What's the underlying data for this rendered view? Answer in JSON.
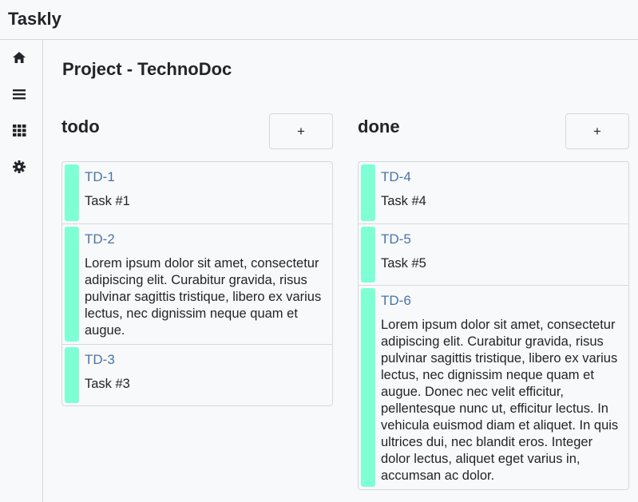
{
  "app": {
    "title": "Taskly"
  },
  "sidebar": {
    "items": [
      {
        "icon": "home-icon"
      },
      {
        "icon": "list-icon"
      },
      {
        "icon": "grid-icon"
      },
      {
        "icon": "gear-icon"
      }
    ]
  },
  "page": {
    "title": "Project - TechnoDoc"
  },
  "columns": [
    {
      "title": "todo",
      "add_label": "+",
      "cards": [
        {
          "id": "TD-1",
          "text": "Task #1"
        },
        {
          "id": "TD-2",
          "text": "Lorem ipsum dolor sit amet, consectetur adipiscing elit. Curabitur gravida, risus pulvinar sagittis tristique, libero ex varius lectus, nec dignissim neque quam et augue."
        },
        {
          "id": "TD-3",
          "text": "Task #3"
        }
      ]
    },
    {
      "title": "done",
      "add_label": "+",
      "cards": [
        {
          "id": "TD-4",
          "text": "Task #4"
        },
        {
          "id": "TD-5",
          "text": "Task #5"
        },
        {
          "id": "TD-6",
          "text": "Lorem ipsum dolor sit amet, consectetur adipiscing elit. Curabitur gravida, risus pulvinar sagittis tristique, libero ex varius lectus, nec dignissim neque quam et augue. Donec nec velit efficitur, pellentesque nunc ut, efficitur lectus. In vehicula euismod diam et aliquet. In quis ultrices dui, nec blandit eros. Integer dolor lectus, aliquet eget varius in, accumsan ac dolor."
        }
      ]
    }
  ],
  "colors": {
    "card_accent": "#7fffd4",
    "link": "#4a74a8"
  }
}
